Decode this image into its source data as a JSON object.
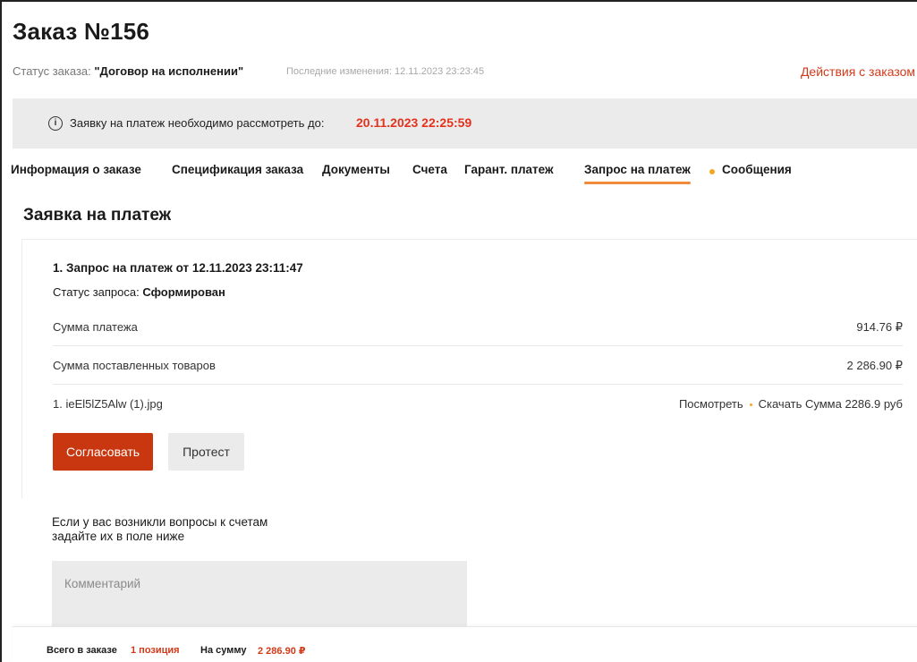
{
  "order": {
    "title": "Заказ №156",
    "status_label": "Статус заказа: ",
    "status_value": "\"Договор на исполнении\"",
    "last_changes_label": "Последние изменения: ",
    "last_changes_value": "12.11.2023 23:23:45",
    "actions_label": "Действия с заказом"
  },
  "notice": {
    "icon": "info-icon",
    "text": "Заявку на платеж необходимо рассмотреть до:",
    "deadline": "20.11.2023 22:25:59"
  },
  "tabs": [
    {
      "label": "Информация о заказе",
      "active": false
    },
    {
      "label": "Спецификация заказа",
      "active": false
    },
    {
      "label": "Документы",
      "active": false
    },
    {
      "label": "Счета",
      "active": false
    },
    {
      "label": "Гарант. платеж",
      "active": false
    },
    {
      "label": "Запрос на платеж",
      "active": true
    },
    {
      "label": "Сообщения",
      "active": false,
      "has_indicator": true
    }
  ],
  "section_title": "Заявка на платеж",
  "request": {
    "title": "1. Запрос на платеж от 12.11.2023 23:11:47",
    "status_label": "Статус запроса: ",
    "status_value": "Сформирован",
    "rows": [
      {
        "label": "Сумма платежа",
        "value": "914.76 ₽"
      },
      {
        "label": "Сумма поставленных товаров",
        "value": "2 286.90 ₽"
      }
    ],
    "file": {
      "name": "1. ieEl5lZ5Alw (1).jpg",
      "view_label": "Посмотреть",
      "download_label": "Скачать",
      "sum_text": "Сумма 2286.9  руб"
    },
    "approve_label": "Согласовать",
    "protest_label": "Протест"
  },
  "questions": {
    "line1": "Если у вас возникли вопросы к счетам",
    "line2": "задайте их в поле ниже",
    "comment_placeholder": "Комментарий"
  },
  "footer": {
    "total_label": "Всего в заказе",
    "total_value": "1 позиция",
    "sum_label": "На сумму",
    "sum_value": "2 286.90 ₽"
  },
  "colors": {
    "accent": "#d23a1a",
    "primary_button": "#c8370f",
    "tab_underline": "#f28a3c",
    "notice_bg": "#ebebeb"
  }
}
